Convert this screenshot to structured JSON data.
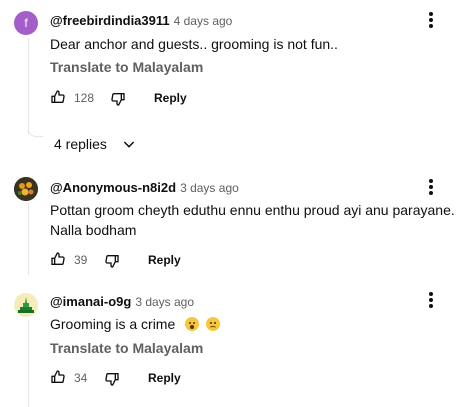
{
  "translate_label": "Translate to Malayalam",
  "reply_label": "Reply",
  "comments": [
    {
      "avatar_letter": "f",
      "avatar_color": "#a35ec9",
      "handle": "@freebirdindia3911",
      "time": "4 days ago",
      "text": "Dear anchor and guests.. grooming is not fun..",
      "likes": "128",
      "replies_label": "4 replies"
    },
    {
      "handle": "@Anonymous-n8i2d",
      "time": "3 days ago",
      "text_line1": "Pottan groom cheyth eduthu ennu enthu proud ayi anu parayane.",
      "text_line2": "Nalla bodham",
      "likes": "39"
    },
    {
      "handle": "@imanai-o9g",
      "time": "3 days ago",
      "text": "Grooming is a crime",
      "likes": "34"
    }
  ]
}
